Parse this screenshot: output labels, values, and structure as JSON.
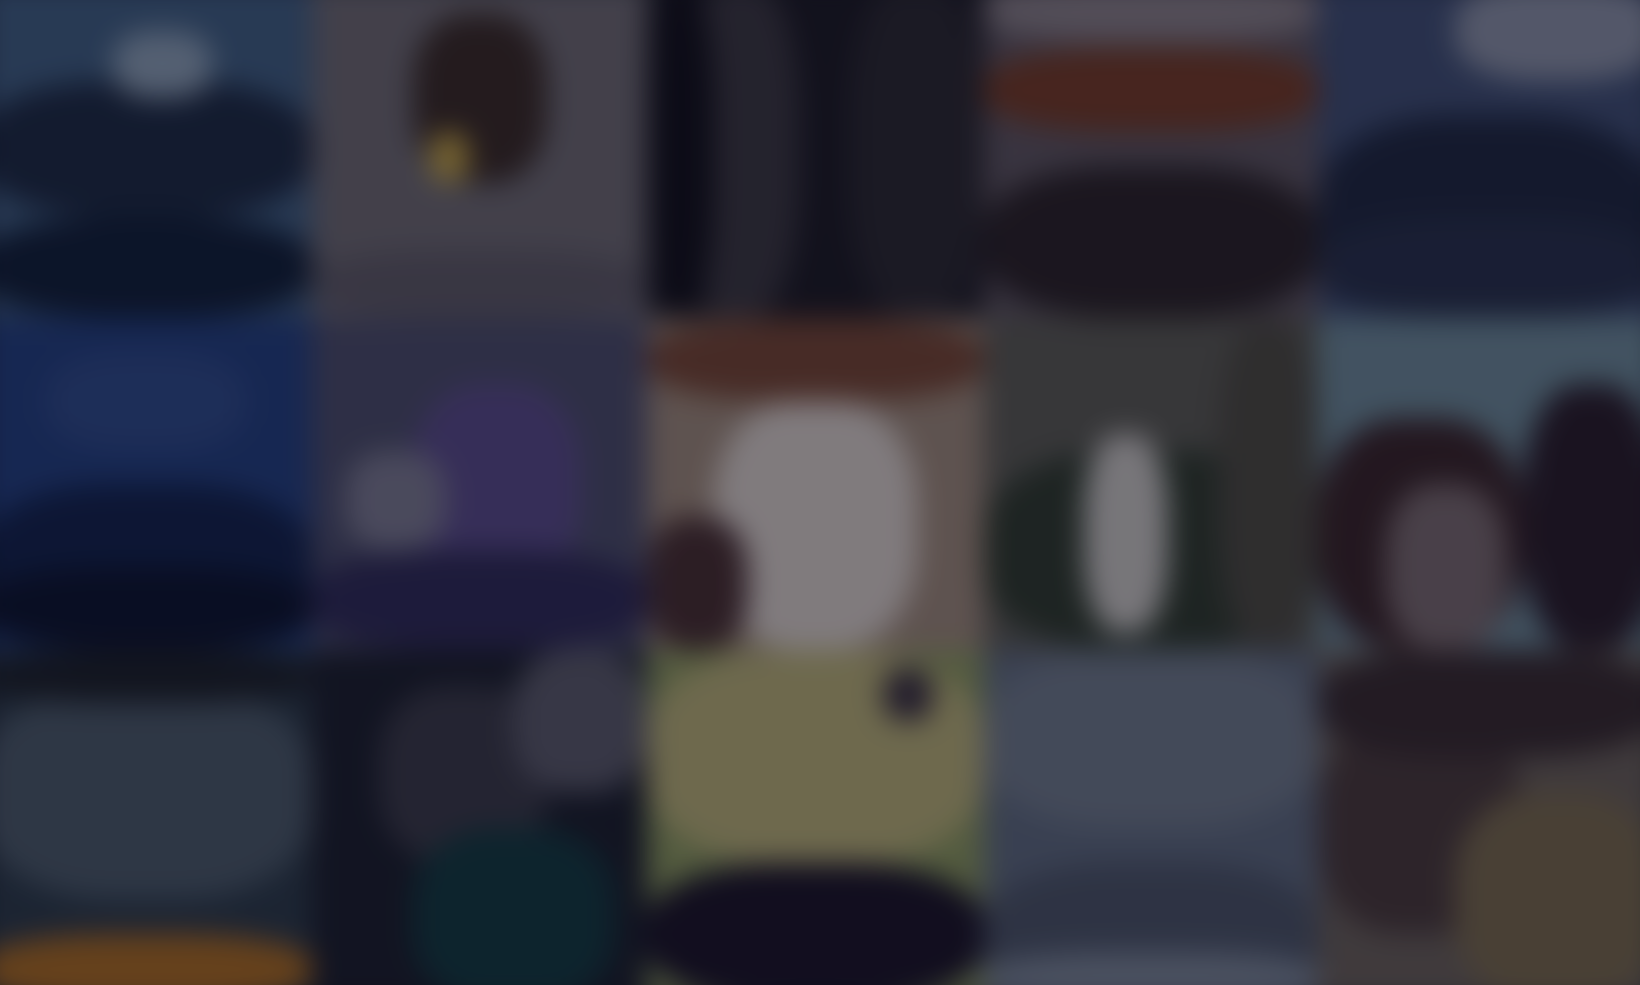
{
  "background": {
    "type": "blurred-photo-grid",
    "columns": 5,
    "rows": 3,
    "tiles": [
      {
        "name": "coast-city-skyline",
        "colors": [
          "#3d5f86",
          "#1b2a45",
          "#8aa0b8",
          "#0f1f3a"
        ]
      },
      {
        "name": "crest-on-wall",
        "colors": [
          "#6e6a72",
          "#3a2a24",
          "#c9a53b",
          "#5e5a66"
        ]
      },
      {
        "name": "dark-doorway",
        "colors": [
          "#1b1a24",
          "#3a3740",
          "#11101a",
          "#2a2830"
        ]
      },
      {
        "name": "tiled-roof-building",
        "colors": [
          "#5e5560",
          "#7a3a22",
          "#2b2226",
          "#8a8088"
        ]
      },
      {
        "name": "blue-city-view",
        "colors": [
          "#3e4f78",
          "#1d2742",
          "#8a92a8",
          "#26304d"
        ]
      },
      {
        "name": "blue-water",
        "colors": [
          "#1f3f85",
          "#102250",
          "#0b1430",
          "#2b4a8f"
        ]
      },
      {
        "name": "purple-vehicle",
        "colors": [
          "#4b4d6c",
          "#5a4a8f",
          "#7b7a92",
          "#2e2a5a"
        ]
      },
      {
        "name": "people-in-white",
        "colors": [
          "#a08a78",
          "#7a4530",
          "#d9cfc8",
          "#4a2e30"
        ]
      },
      {
        "name": "garden-figure",
        "colors": [
          "#5a5a52",
          "#2e3a2c",
          "#c9c6c2",
          "#4c4a40"
        ]
      },
      {
        "name": "people-on-coast",
        "colors": [
          "#6a8a9a",
          "#3a2428",
          "#7a6a6e",
          "#2a1d2a"
        ]
      },
      {
        "name": "city-street",
        "colors": [
          "#2a3a4a",
          "#4a5a6a",
          "#b06a18",
          "#1a2028"
        ]
      },
      {
        "name": "portrait-shadow",
        "colors": [
          "#1a1e2c",
          "#3a3a48",
          "#0f3a40",
          "#5a5a6a"
        ]
      },
      {
        "name": "sunlit-field",
        "colors": [
          "#8a9a58",
          "#b9b070",
          "#1a1428",
          "#3a3040"
        ]
      },
      {
        "name": "pale-sky",
        "colors": [
          "#5d6a80",
          "#6e7a8c",
          "#4a5468",
          "#7a8698"
        ]
      },
      {
        "name": "crowd-scene",
        "colors": [
          "#6a6058",
          "#4a3a3a",
          "#7a6a4a",
          "#382a2e"
        ]
      }
    ],
    "overlay_color": "#080816"
  }
}
